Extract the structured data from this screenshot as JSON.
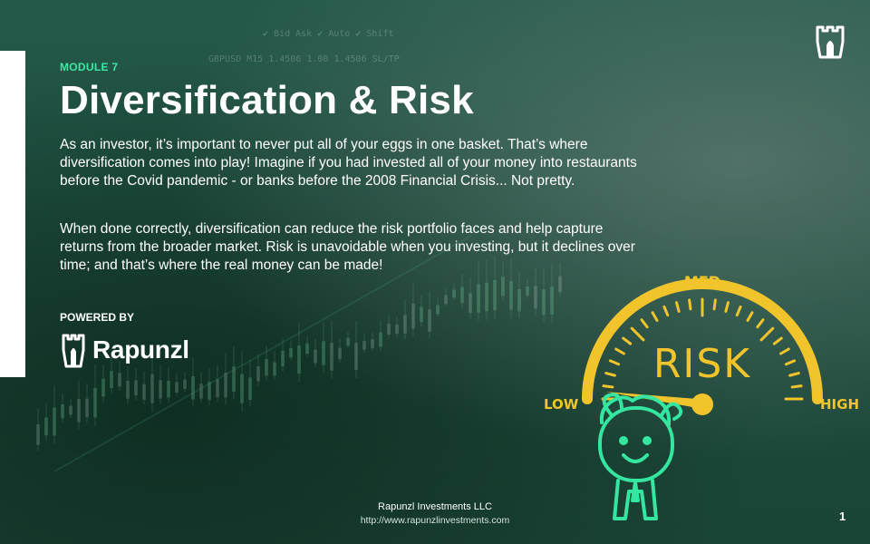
{
  "slide": {
    "module_label": "MODULE 7",
    "title": "Diversification & Risk",
    "paragraph_1": "As an investor, it’s important to never put all of  your eggs in one basket. That’s where diversification comes into play! Imagine if you had invested all of your money into restaurants before the Covid pandemic - or banks before the 2008 Financial Crisis... Not pretty.",
    "paragraph_2": "When done correctly, diversification can reduce the risk portfolio faces and help capture returns from the broader market.  Risk is unavoidable when you investing, but it declines over time; and that’s where the real money can be made!",
    "powered_by": "POWERED BY",
    "brand_name": "Rapunzl",
    "background_ticker": "GBPUSD M15  1.4506  1.00  1.4506  SL/TP",
    "background_menu": "✔ Bid   Ask ✔ Auto ✔ Shift"
  },
  "gauge": {
    "low": "LOW",
    "med": "MED",
    "high": "HIGH",
    "center": "RISK"
  },
  "footer": {
    "company": "Rapunzl Investments LLC",
    "url": "http://www.rapunzlinvestments.com",
    "page_number": "1"
  },
  "colors": {
    "accent_green": "#3ee8a4",
    "gauge_yellow": "#f2c42c",
    "mascot_green": "#34e6a0",
    "background": "#1f4a3a"
  },
  "icons": {
    "corner_logo": "rapunzl-tower-icon",
    "brand_logo": "rapunzl-tower-icon"
  }
}
